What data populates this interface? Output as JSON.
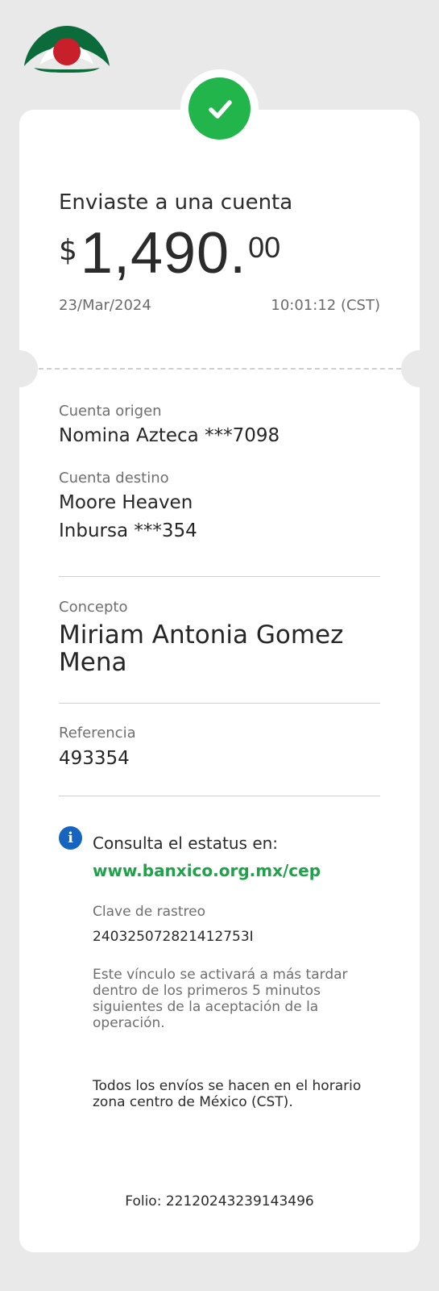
{
  "receipt": {
    "title": "Enviaste a una cuenta",
    "amount": {
      "currency_symbol": "$",
      "integer": "1,490.",
      "decimals": "00"
    },
    "date": "23/Mar/2024",
    "time": "10:01:12 (CST)"
  },
  "details": {
    "origin_label": "Cuenta origen",
    "origin_value": "Nomina Azteca ***7098",
    "dest_label": "Cuenta destino",
    "dest_name": "Moore Heaven",
    "dest_account": "Inbursa ***354",
    "concept_label": "Concepto",
    "concept_value": "Miriam Antonia Gomez Mena",
    "reference_label": "Referencia",
    "reference_value": "493354"
  },
  "status": {
    "consulta_text": "Consulta el estatus en:",
    "link_text": "www.banxico.org.mx/cep",
    "clave_label": "Clave de rastreo",
    "clave_value": "240325072821412753I",
    "note": "Este vínculo se activará a más tardar dentro de los primeros 5 minutos siguientes de la aceptación de la operación.",
    "timezone_note": "Todos los envíos se hacen en el horario zona centro de México (CST)."
  },
  "folio": "Folio: 22120243239143496",
  "colors": {
    "success_green": "#21b54b",
    "link_green": "#1fa24a",
    "info_blue": "#1565c0",
    "brand_green": "#0b6b3a",
    "brand_red": "#c8202a"
  },
  "icons": {
    "logo": "bank-logo-icon",
    "success": "checkmark-icon",
    "info": "info-icon"
  }
}
